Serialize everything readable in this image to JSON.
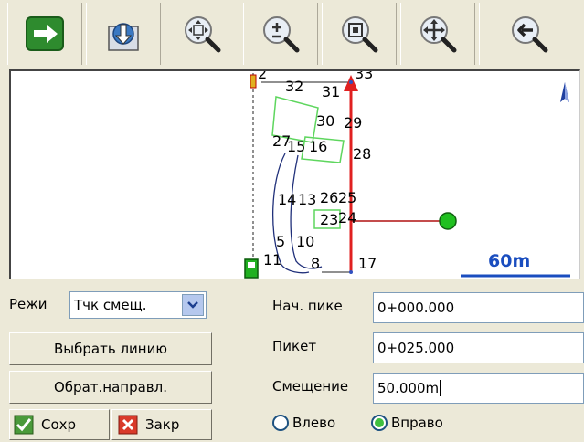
{
  "toolbar": {
    "buttons": [
      {
        "icon": "arrow-right-icon"
      },
      {
        "icon": "download-icon"
      },
      {
        "icon": "zoom-extent-icon"
      },
      {
        "icon": "zoom-in-out-icon"
      },
      {
        "icon": "zoom-window-icon"
      },
      {
        "icon": "pan-icon"
      },
      {
        "icon": "zoom-previous-icon"
      }
    ]
  },
  "map": {
    "point_labels": [
      "2",
      "32",
      "31",
      "33",
      "30",
      "29",
      "27",
      "15",
      "16",
      "28",
      "14",
      "13",
      "26",
      "25",
      "23",
      "24",
      "5",
      "10",
      "11",
      "8",
      "17"
    ],
    "scale_label": "60m",
    "north_label": "N"
  },
  "form": {
    "mode_label": "Режи",
    "mode_value": "Тчк смещ.",
    "select_line_label": "Выбрать линию",
    "reverse_label": "Обрат.направл.",
    "save_label": "Сохр",
    "close_label": "Закр",
    "start_station_label": "Нач. пике",
    "start_station_value": "0+000.000",
    "station_label": "Пикет",
    "station_value": "0+025.000",
    "offset_label": "Смещение",
    "offset_value": "50.000m",
    "left_label": "Влево",
    "right_label": "Вправо",
    "selected_side": "Вправо"
  },
  "colors": {
    "accent": "#1a4dbf",
    "alignment": "#e02020",
    "point": "#20c020",
    "parcel": "#5ed65e"
  }
}
